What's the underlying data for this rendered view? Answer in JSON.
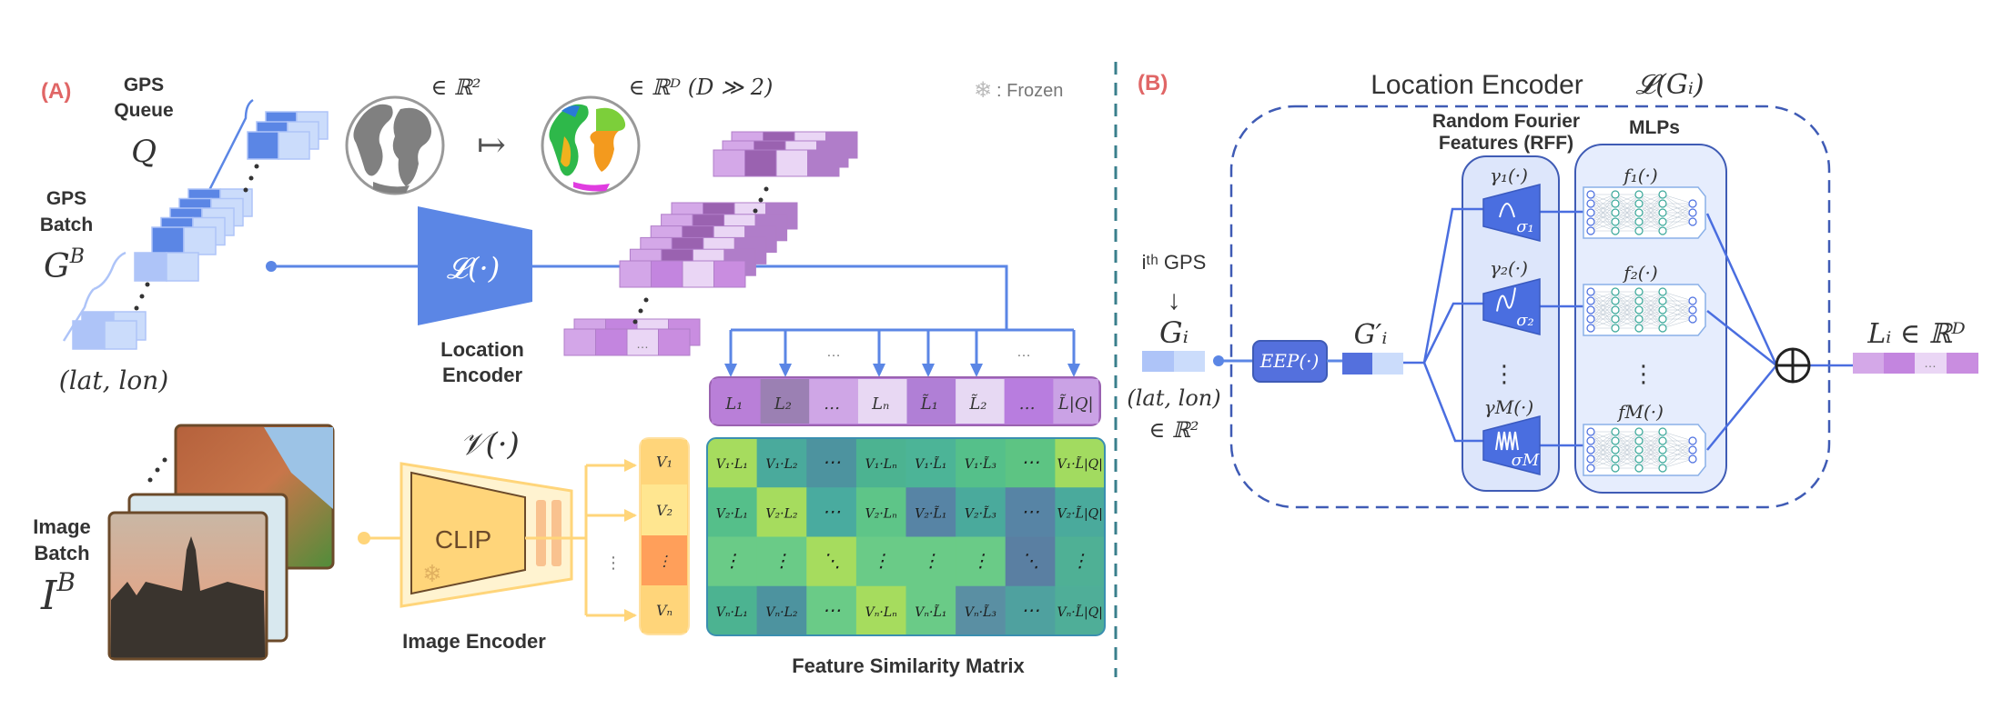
{
  "colors": {
    "panel_label": "#e06666",
    "blue_line": "#5b86e5",
    "encoder_blue": "#5b86e5",
    "clip_yellow": "#ffd57a",
    "divider": "#3a7f8c",
    "dashed_box": "#3f5bb5"
  },
  "panel_a": {
    "label": "(A)",
    "gps_queue_label_1": "GPS",
    "gps_queue_label_2": "Queue",
    "gps_queue_symbol": "Q",
    "gps_batch_label_1": "GPS",
    "gps_batch_label_2": "Batch",
    "gps_batch_symbol": "G",
    "gps_batch_symbol_sup": "B",
    "latlon": "(lat, lon)",
    "in_r2": "∈ ℝ²",
    "maps_to": "↦",
    "in_rd": "∈ ℝᴰ (D ≫ 2)",
    "frozen_legend": ": Frozen",
    "frozen_icon": "snowflake-icon",
    "location_encoder_symbol": "𝓛(·)",
    "location_encoder_label_1": "Location",
    "location_encoder_label_2": "Encoder",
    "image_batch_label_1": "Image",
    "image_batch_label_2": "Batch",
    "image_batch_symbol": "I",
    "image_batch_symbol_sup": "B",
    "image_encoder_symbol": "𝒱(·)",
    "clip_label": "CLIP",
    "image_encoder_label": "Image Encoder",
    "location_features": [
      "L₁",
      "L₂",
      "…",
      "Lₙ",
      "L̃₁",
      "L̃₂",
      "…",
      "L̃|Q|"
    ],
    "location_feature_colors": [
      "#b97fd8",
      "#9b80b3",
      "#cfa6e6",
      "#e8d8f3",
      "#b07fd6",
      "#e7d9f3",
      "#b87ddf",
      "#caa2e5"
    ],
    "arrow_ellipsis": "…",
    "image_features": [
      "V₁",
      "V₂",
      "⋮",
      "Vₙ"
    ],
    "image_feature_colors": [
      "#ffd57a",
      "#ffe690",
      "#ff9f5a",
      "#ffd57a"
    ],
    "similarity_matrix": {
      "title": "Feature Similarity Matrix",
      "cells": [
        [
          "V₁·L₁",
          "V₁·L₂",
          "⋯",
          "V₁·Lₙ",
          "V₁·L̃₁",
          "V₁·L̃₃",
          "⋯",
          "V₁·L̃|Q|"
        ],
        [
          "V₂·L₁",
          "V₂·L₂",
          "⋯",
          "V₂·Lₙ",
          "V₂·L̃₁",
          "V₂·L̃₃",
          "⋯",
          "V₂·L̃|Q|"
        ],
        [
          "⋮",
          "⋮",
          "⋱",
          "⋮",
          "⋮",
          "⋮",
          "⋱",
          "⋮"
        ],
        [
          "Vₙ·L₁",
          "Vₙ·L₂",
          "⋯",
          "Vₙ·Lₙ",
          "Vₙ·L̃₁",
          "Vₙ·L̃₃",
          "⋯",
          "Vₙ·L̃|Q|"
        ]
      ],
      "cell_colors": [
        [
          "#a6dc5e",
          "#4aaa9c",
          "#4d939f",
          "#4cb391",
          "#4cb497",
          "#55c08a",
          "#5dc483",
          "#a2db60"
        ],
        [
          "#55bf8a",
          "#a6dc5e",
          "#49ab9f",
          "#5ec588",
          "#5784a5",
          "#4aaa9c",
          "#5784a5",
          "#4aaa9c"
        ],
        [
          "#6acb87",
          "#6acb87",
          "#a6dc5e",
          "#6acb87",
          "#6acb87",
          "#6acb87",
          "#5a7fa2",
          "#4fb095"
        ],
        [
          "#4cb391",
          "#4d939f",
          "#6acb87",
          "#a6dc5e",
          "#6acb87",
          "#5a8fa3",
          "#4fa19f",
          "#4fae98"
        ]
      ]
    }
  },
  "panel_b": {
    "label": "(B)",
    "title": "Location Encoder",
    "title_symbol": "𝓛(Gᵢ)",
    "input_label": "iᵗʰ GPS",
    "input_arrow": "↓",
    "input_symbol": "Gᵢ",
    "input_latlon": "(lat, lon)",
    "input_space": "∈ ℝ²",
    "eep_label": "EEP(·)",
    "eep_output_symbol": "G′ᵢ",
    "rff_title_1": "Random Fourier",
    "rff_title_2": "Features (RFF)",
    "mlp_title": "MLPs",
    "rff_branches": [
      {
        "gamma": "γ₁(·)",
        "sigma": "σ₁",
        "wave_icon": "single-bump-wave-icon"
      },
      {
        "gamma": "γ₂(·)",
        "sigma": "σ₂",
        "wave_icon": "sine-wave-icon"
      },
      {
        "gamma": "γM(·)",
        "sigma": "σM",
        "wave_icon": "high-frequency-wave-icon"
      }
    ],
    "mlp_branches": [
      "f₁(·)",
      "f₂(·)",
      "fM(·)"
    ],
    "vertical_ellipsis": "⋮",
    "sum_icon": "circled-plus-icon",
    "output_symbol": "Lᵢ ∈ ℝᴰ",
    "output_ellipsis": "…"
  }
}
